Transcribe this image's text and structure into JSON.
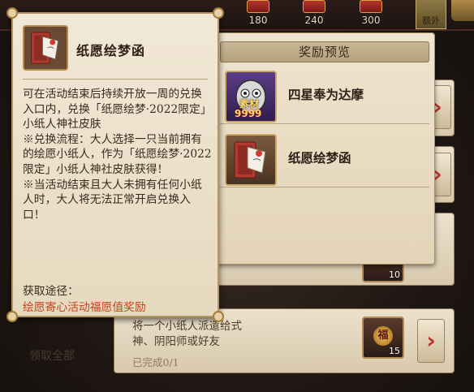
{
  "top_strip": {
    "milestones": [
      "180",
      "240",
      "300"
    ],
    "extra_label": "额外"
  },
  "background_tasks": {
    "item_qty_upper": "10",
    "task_description": "将一个小纸人派遣给式\n神、阴阳师或好友",
    "task_progress": "已完成0/1",
    "task_item_qty": "15",
    "task_item_glyph": "福",
    "arrow_glyph": "›",
    "bottom_left_label": "领取全部"
  },
  "reward_preview": {
    "title": "奖励预览",
    "rewards": [
      {
        "name": "四星奉为达摩",
        "icon": "daruma-icon",
        "badge": "素材",
        "count": "9999"
      },
      {
        "name": "纸愿绘梦函",
        "icon": "letter-box-icon"
      }
    ]
  },
  "tooltip": {
    "title": "纸愿绘梦函",
    "icon": "letter-box-icon",
    "description": "可在活动结束后持续开放一周的兑换入口内，兑换「纸愿绘梦·2022限定」小纸人神社皮肤\n※兑换流程：大人选择一只当前拥有的绘愿小纸人，作为「纸愿绘梦·2022限定」小纸人神社皮肤获得！\n※当活动结束且大人未拥有任何小纸人时，大人将无法正常开启兑换入口！",
    "source_label": "获取途径：",
    "source": "绘愿寄心活动福愿值奖励"
  },
  "colors": {
    "accent_red": "#c4421d",
    "parchment": "#efe4cf",
    "gold_border": "#b3945e"
  }
}
